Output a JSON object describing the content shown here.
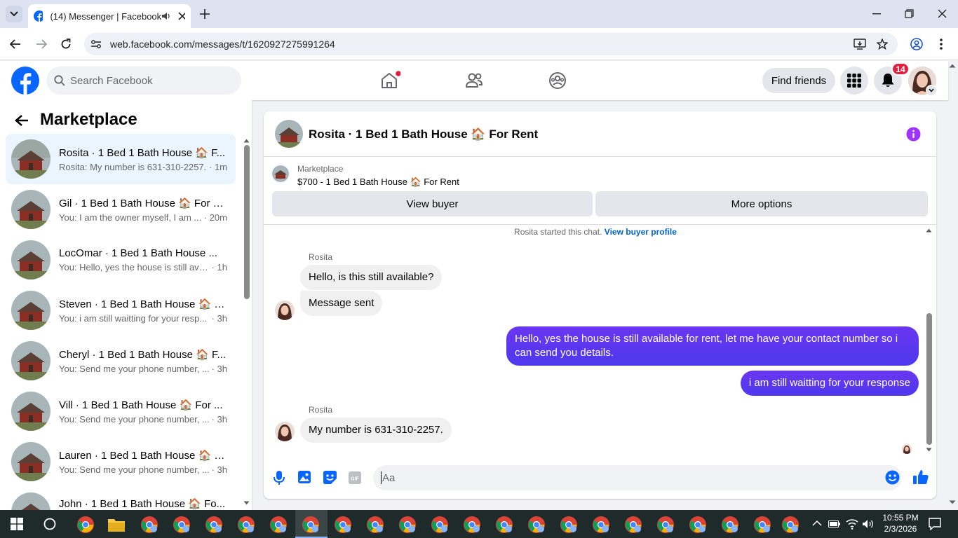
{
  "browser": {
    "tab_title": "(14) Messenger | Facebook",
    "url": "web.facebook.com/messages/t/1620927275991264"
  },
  "fb_header": {
    "search_placeholder": "Search Facebook",
    "find_friends": "Find friends",
    "notification_count": "14"
  },
  "sidebar": {
    "title": "Marketplace",
    "conversations": [
      {
        "name": "Rosita · 1 Bed 1 Bath House 🏠 F...",
        "message": "Rosita: My number is 631-310-2257.",
        "time": "· 1m",
        "selected": true
      },
      {
        "name": "Gil · 1 Bed 1 Bath House 🏠 For R...",
        "message": "You: I am the owner myself, I am ...",
        "time": "· 20m"
      },
      {
        "name": "LocOmar · 1 Bed 1 Bath House ...",
        "message": "You: Hello, yes the house is still avai...",
        "time": "· 1h"
      },
      {
        "name": "Steven · 1 Bed 1 Bath House 🏠 F...",
        "message": "You: i am still waitting for your resp...",
        "time": "· 3h"
      },
      {
        "name": "Cheryl · 1 Bed 1 Bath House 🏠 F...",
        "message": "You: Send me your phone number, ...",
        "time": "· 3h"
      },
      {
        "name": "Vill · 1 Bed 1 Bath House 🏠 For ...",
        "message": "You: Send me your phone number, ...",
        "time": "· 3h"
      },
      {
        "name": "Lauren · 1 Bed 1 Bath House 🏠 F...",
        "message": "You: Send me your phone number, ...",
        "time": "· 3h"
      },
      {
        "name": "John · 1 Bed 1 Bath House 🏠 Fo...",
        "message": "",
        "time": ""
      }
    ]
  },
  "chat": {
    "title": "Rosita · 1 Bed 1 Bath House 🏠 For Rent",
    "listing_label": "Marketplace",
    "listing_title": "$700 - 1 Bed 1 Bath House 🏠 For Rent",
    "view_buyer": "View buyer",
    "more_options": "More options",
    "started_text": "Rosita started this chat.",
    "view_buyer_profile": "View buyer profile",
    "messages": [
      {
        "sender": "Rosita",
        "text": "Hello, is this still available?",
        "dir": "in"
      },
      {
        "sender": "",
        "text": "Message sent",
        "dir": "in"
      },
      {
        "sender": "",
        "text": "Hello, yes the house is still available for rent, let me have your contact number so i can send you  details.",
        "dir": "out"
      },
      {
        "sender": "",
        "text": "i am still waitting for your response",
        "dir": "out"
      },
      {
        "sender": "Rosita",
        "text": "My number is 631-310-2257.",
        "dir": "in"
      }
    ],
    "input_placeholder": "Aa"
  },
  "taskbar": {
    "time": "10:55 PM",
    "date": "2/3/2026"
  },
  "colors": {
    "fb_blue": "#0866ff",
    "outgoing_bubble": "#4d38ee",
    "link": "#0064d1",
    "badge_red": "#e41e3f",
    "info_purple": "#a033ff"
  }
}
